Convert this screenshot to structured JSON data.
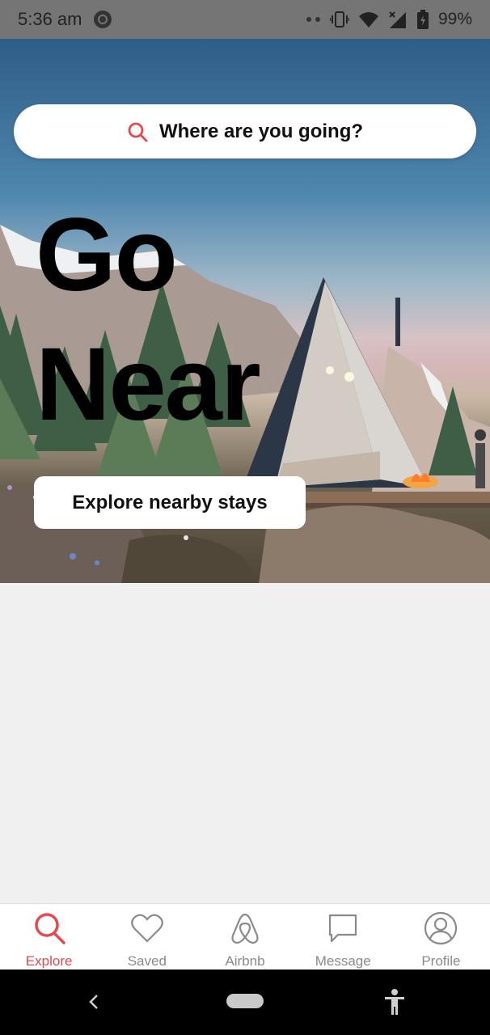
{
  "status_bar": {
    "time": "5:36 am",
    "battery": "99%",
    "icons": [
      "app-notification-icon",
      "vibrate-icon",
      "wifi-icon",
      "signal-icon",
      "battery-icon"
    ]
  },
  "search": {
    "label": "Where are you going?"
  },
  "hero": {
    "headline_line1": "Go",
    "headline_line2": "Near",
    "cta_label": "Explore nearby stays"
  },
  "bottom_nav": {
    "active": "Explore",
    "accent_color": "#e5484d",
    "items": [
      {
        "label": "Explore",
        "icon": "search-icon"
      },
      {
        "label": "Saved",
        "icon": "heart-icon"
      },
      {
        "label": "Airbnb",
        "icon": "airbnb-logo-icon"
      },
      {
        "label": "Message",
        "icon": "message-icon"
      },
      {
        "label": "Profile",
        "icon": "profile-icon"
      }
    ]
  }
}
